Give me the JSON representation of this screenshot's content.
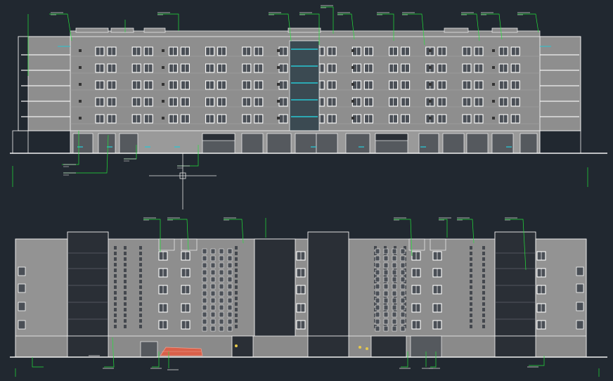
{
  "drawing": {
    "background": "#212830",
    "colors": {
      "line": "#f2f2f2",
      "wall": "#8e8e8e",
      "window_frame": "#ffffff",
      "window_glass": "#4a4f56",
      "leader": "#22e33a",
      "glass_blue": "#28c7d3",
      "accent_red": "#d9604a",
      "dark_panel": "#2a2f36"
    },
    "symbols": [
      "crosshair-icon"
    ]
  }
}
